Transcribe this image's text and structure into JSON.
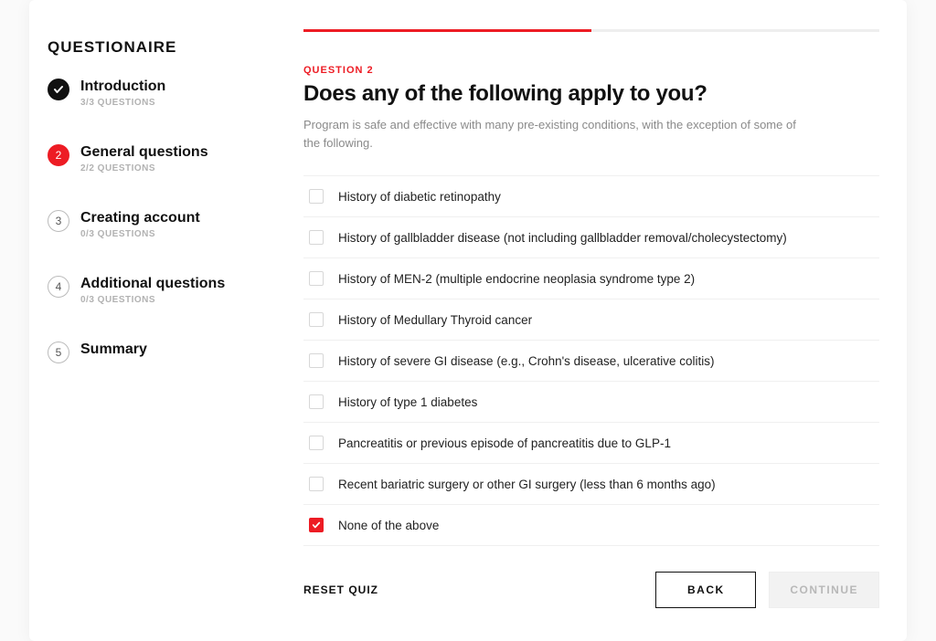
{
  "sidebar": {
    "title": "QUESTIONAIRE",
    "steps": [
      {
        "label": "Introduction",
        "sub": "3/3 QUESTIONS",
        "state": "done"
      },
      {
        "label": "General questions",
        "sub": "2/2 QUESTIONS",
        "state": "active",
        "num": "2"
      },
      {
        "label": "Creating account",
        "sub": "0/3 QUESTIONS",
        "state": "todo",
        "num": "3"
      },
      {
        "label": "Additional questions",
        "sub": "0/3 QUESTIONS",
        "state": "todo",
        "num": "4"
      },
      {
        "label": "Summary",
        "sub": "",
        "state": "todo",
        "num": "5"
      }
    ]
  },
  "main": {
    "progress_percent": 50,
    "question_label": "QUESTION 2",
    "question_title": "Does any of the following apply to you?",
    "question_desc": "Program is safe and effective with many pre-existing conditions, with the exception of some of the following.",
    "options": [
      {
        "label": "History of diabetic retinopathy",
        "checked": false
      },
      {
        "label": "History of gallbladder disease (not including gallbladder removal/cholecystectomy)",
        "checked": false
      },
      {
        "label": "History of MEN-2 (multiple endocrine neoplasia syndrome type 2)",
        "checked": false
      },
      {
        "label": "History of Medullary Thyroid cancer",
        "checked": false
      },
      {
        "label": "History of severe GI disease (e.g., Crohn's disease, ulcerative colitis)",
        "checked": false
      },
      {
        "label": "History of type 1 diabetes",
        "checked": false
      },
      {
        "label": "Pancreatitis or previous episode of pancreatitis due to GLP-1",
        "checked": false
      },
      {
        "label": "Recent bariatric surgery or other GI surgery (less than 6 months ago)",
        "checked": false
      },
      {
        "label": "None of the above",
        "checked": true
      }
    ],
    "footer": {
      "reset": "RESET QUIZ",
      "back": "BACK",
      "continue": "CONTINUE",
      "continue_enabled": false
    }
  }
}
